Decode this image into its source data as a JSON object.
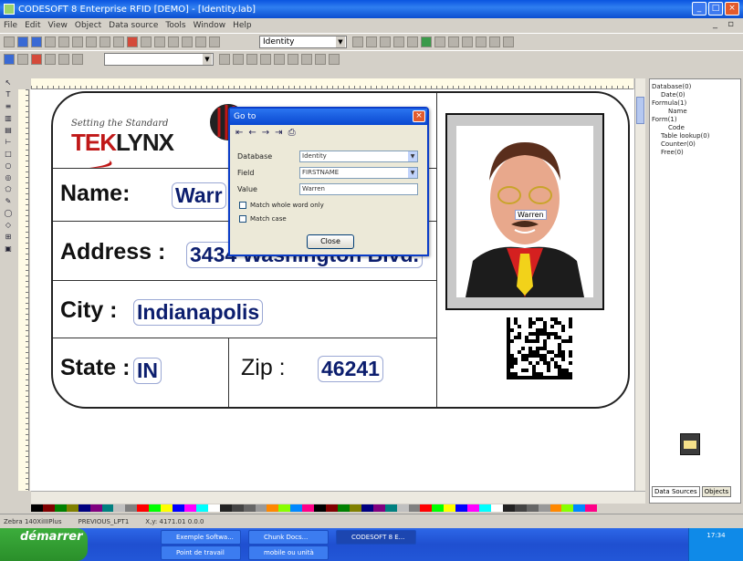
{
  "window": {
    "title": "CODESOFT 8 Enterprise RFID [DEMO] - [Identity.lab]"
  },
  "menu": [
    "File",
    "Edit",
    "View",
    "Object",
    "Data source",
    "Tools",
    "Window",
    "Help"
  ],
  "toolbar": {
    "combo_identity": "Identity"
  },
  "label": {
    "logo_tagline": "Setting the Standard",
    "logo_brand_red": "TEK",
    "logo_brand_black": "LYNX",
    "name_label": "Name:",
    "name_value": "Warr",
    "address_label": "Address :",
    "address_value": "3434 Washington Blvd.",
    "city_label": "City :",
    "city_value": "Indianapolis",
    "state_label": "State :",
    "state_value": "IN",
    "zip_label": "Zip :",
    "zip_value": "46241",
    "photo_caption": "Warren"
  },
  "dialog": {
    "title": "Go to",
    "database_label": "Database",
    "database_value": "Identity",
    "field_label": "Field",
    "field_value": "FIRSTNAME",
    "value_label": "Value",
    "value_value": "Warren",
    "match_whole_word": "Match whole word only",
    "match_case": "Match case",
    "close_label": "Close"
  },
  "tree": [
    "Database(0)",
    "Date(0)",
    "Formula(1)",
    "Name",
    "Form(1)",
    "Code",
    "Table lookup(0)",
    "Counter(0)",
    "Free(0)"
  ],
  "panel_tabs": [
    "Data Sources",
    "Objects"
  ],
  "status": [
    "Zebra 140XiIIIPlus",
    "PREVIOUS_LPT1",
    "X,y: 4171.01 0.0.0"
  ],
  "taskbar": {
    "start": "démarrer",
    "tasks": [
      "Exemple Softwa...",
      "Chunk Docs...",
      "CODESOFT 8 E...",
      "Point de travail",
      "mobile ou unità"
    ],
    "tray_time": "17:34"
  },
  "colors": {
    "title_blue": "#0a54e0",
    "label_value_blue": "#0c1e6e",
    "logo_red": "#c01818"
  }
}
